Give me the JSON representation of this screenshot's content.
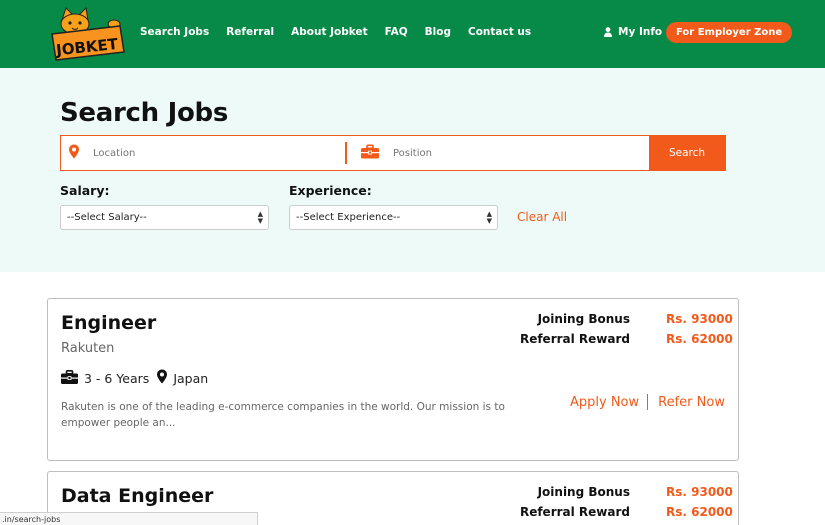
{
  "header": {
    "logo_text": "JOBKET",
    "nav": [
      "Search Jobs",
      "Referral",
      "About Jobket",
      "FAQ",
      "Blog",
      "Contact us"
    ],
    "my_info": "My Info",
    "employer_zone": "For Employer Zone",
    "bg_color": "#078a47",
    "accent_color": "#f15a1a"
  },
  "search": {
    "title": "Search Jobs",
    "location_placeholder": "Location",
    "position_placeholder": "Position",
    "button": "Search",
    "location_icon": "map-pin-icon",
    "position_icon": "briefcase-icon"
  },
  "filters": {
    "salary_label": "Salary:",
    "salary_selected": "--Select Salary--",
    "experience_label": "Experience:",
    "experience_selected": "--Select Experience--",
    "clear_all": "Clear All"
  },
  "jobs": [
    {
      "title": "Engineer",
      "company": "Rakuten",
      "experience": "3 - 6 Years",
      "location": "Japan",
      "description": "Rakuten is one of the leading e-commerce companies in the world. Our mission is to empower people an...",
      "joining_bonus_label": "Joining Bonus",
      "joining_bonus": "Rs. 93000",
      "referral_reward_label": "Referral Reward",
      "referral_reward": "Rs. 62000",
      "apply": "Apply Now",
      "refer": "Refer Now"
    },
    {
      "title": "Data Engineer",
      "joining_bonus_label": "Joining Bonus",
      "joining_bonus": "Rs. 93000",
      "referral_reward_label": "Referral Reward",
      "referral_reward": "Rs. 62000"
    }
  ],
  "status_url": ".in/search-jobs"
}
